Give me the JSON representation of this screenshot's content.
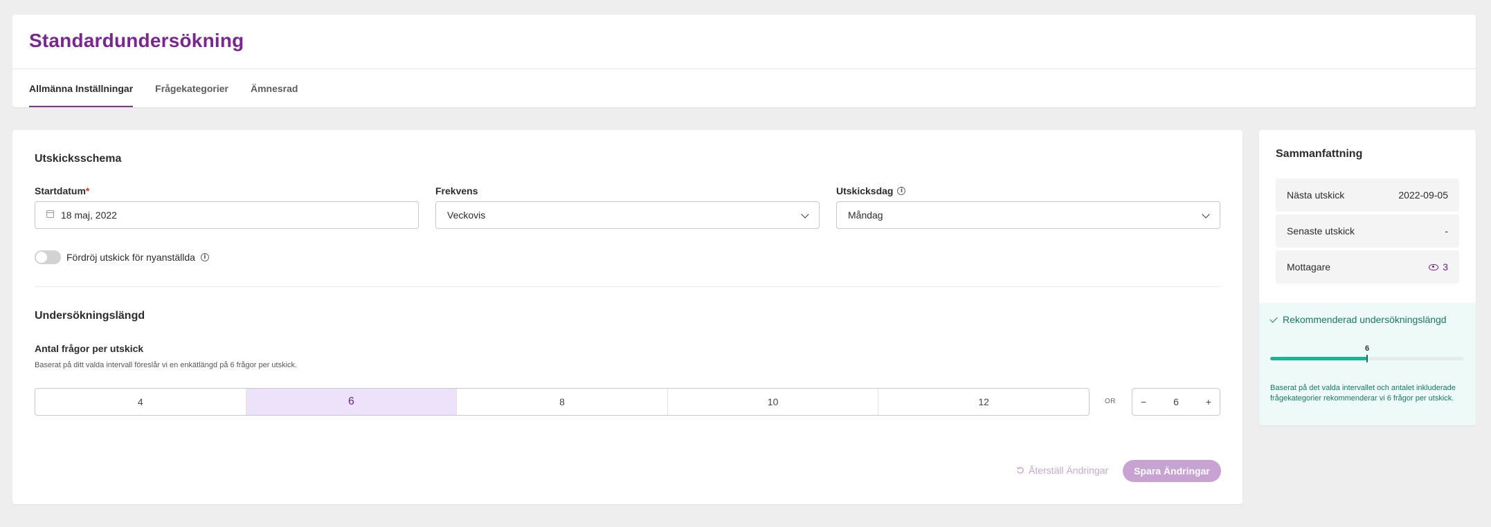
{
  "header": {
    "title": "Standardundersökning",
    "tabs": [
      {
        "label": "Allmänna Inställningar",
        "active": true
      },
      {
        "label": "Frågekategorier",
        "active": false
      },
      {
        "label": "Ämnesrad",
        "active": false
      }
    ]
  },
  "schedule": {
    "section_title": "Utskicksschema",
    "start_date": {
      "label": "Startdatum",
      "required_mark": "*",
      "value": "18 maj, 2022",
      "icon": "calendar-icon"
    },
    "frequency": {
      "label": "Frekvens",
      "value": "Veckovis",
      "icon": "chevron-down-icon"
    },
    "send_day": {
      "label": "Utskicksdag",
      "value": "Måndag",
      "icon": "chevron-down-icon",
      "info_icon": "info-icon"
    },
    "delay_toggle": {
      "label": "Fördröj utskick för nyanställda",
      "checked": false
    }
  },
  "length": {
    "section_title": "Undersökningslängd",
    "questions_label": "Antal frågor per utskick",
    "helper": "Baserat på ditt valda intervall föreslår vi en enkätlängd på 6 frågor per utskick.",
    "options": [
      "4",
      "6",
      "8",
      "10",
      "12"
    ],
    "selected": "6",
    "or_label": "OR",
    "stepper": {
      "minus": "−",
      "value": "6",
      "plus": "+"
    }
  },
  "actions": {
    "reset_label": "Återställ Ändringar",
    "save_label": "Spara Ändringar"
  },
  "summary": {
    "title": "Sammanfattning",
    "rows": [
      {
        "label": "Nästa utskick",
        "value": "2022-09-05"
      },
      {
        "label": "Senaste utskick",
        "value": "-"
      },
      {
        "label": "Mottagare",
        "value": "3",
        "icon": "eye-icon"
      }
    ],
    "recommendation": {
      "title": "Rekommenderad undersökningslängd",
      "value": "6",
      "level_fraction": 0.5,
      "text": "Baserat på det valda intervallet och antalet inkluderade frågekategorier rekommenderar vi 6 frågor per utskick."
    }
  },
  "colors": {
    "brand": "#7b2593",
    "accent_light": "#ece3fa",
    "success": "#147a62",
    "success_bar": "#1bb394",
    "disabled_button": "#c9a2d4"
  }
}
